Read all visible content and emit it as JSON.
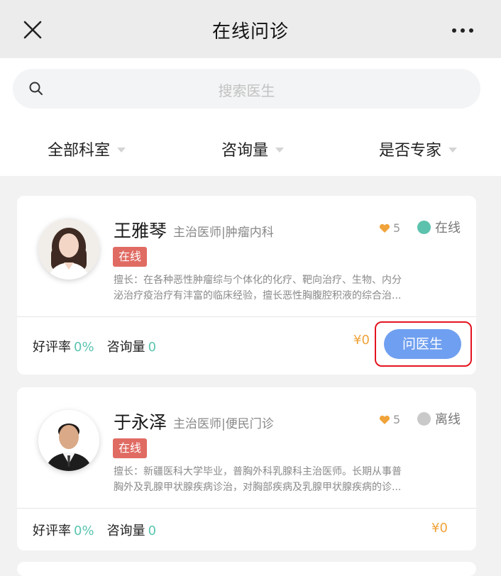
{
  "header": {
    "title": "在线问诊",
    "close_icon": "close-icon",
    "more_icon": "more-icon"
  },
  "search": {
    "placeholder": "搜索医生",
    "icon": "search-icon"
  },
  "filters": [
    {
      "label": "全部科室"
    },
    {
      "label": "咨询量"
    },
    {
      "label": "是否专家"
    }
  ],
  "doctors": [
    {
      "name": "王雅琴",
      "title": "主治医师|肿瘤内科",
      "likes": "5",
      "status": "在线",
      "tag": "在线",
      "desc_line1": "擅长：在各种恶性肿瘤综与个体化的化疗、靶向治疗、生物、内分",
      "desc_line2": "泌治疗疫治疗有沣富的临床经验，擅长恶性胸腹腔积液的综合治...",
      "rating_label": "好评率",
      "rating_value": "0%",
      "consult_label": "咨询量",
      "consult_value": "0",
      "price": "¥0",
      "button": "问医生"
    },
    {
      "name": "于永泽",
      "title": "主治医师|便民门诊",
      "likes": "5",
      "status": "离线",
      "tag": "在线",
      "desc_line1": "擅长：新疆医科大学毕业，普胸外科乳腺科主治医师。长期从事普",
      "desc_line2": "胸外及乳腺甲状腺疾病诊治，对胸部疾病及乳腺甲状腺疾病的诊...",
      "rating_label": "好评率",
      "rating_value": "0%",
      "consult_label": "咨询量",
      "consult_value": "0",
      "price": "¥0"
    }
  ],
  "colors": {
    "online_dot": "#5cc2ad",
    "offline_dot": "#c9c9c9",
    "tag": "#e06b63",
    "accent_teal": "#5bc4b0",
    "price": "#f0a33a",
    "button": "#6f9ff0",
    "highlight": "#e4151f"
  }
}
